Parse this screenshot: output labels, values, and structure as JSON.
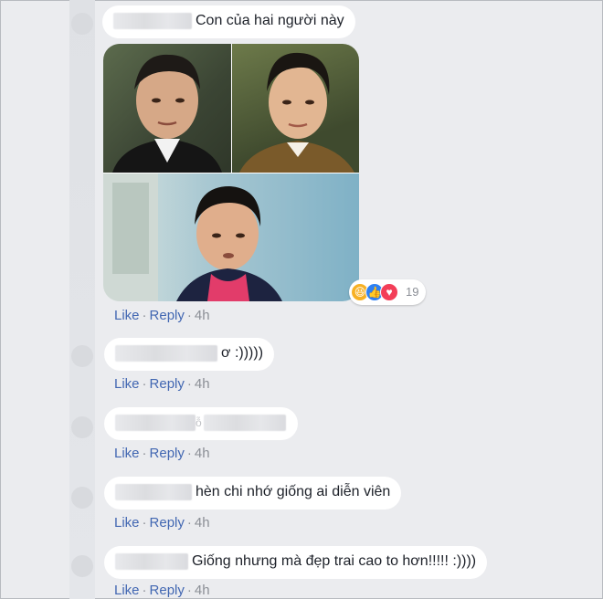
{
  "comments": [
    {
      "text": "Con của hai người này"
    },
    {
      "text": "ơ :)))))"
    },
    {
      "text": "ỗ"
    },
    {
      "text": "hèn chi nhớ giống ai diễn viên"
    },
    {
      "text": "Giống nhưng mà đẹp trai cao to hơn!!!!! :))))"
    }
  ],
  "actions": {
    "like": "Like",
    "reply": "Reply",
    "time": "4h",
    "separator": "·"
  },
  "reactions": {
    "count": "19",
    "icons": [
      "haha-icon",
      "like-icon",
      "love-icon"
    ]
  },
  "colors": {
    "link": "#4267b2",
    "meta": "#8b8f96",
    "bubble": "#ffffff",
    "haha": "#f7b125",
    "like": "#2e81f4",
    "love": "#f33e58"
  }
}
